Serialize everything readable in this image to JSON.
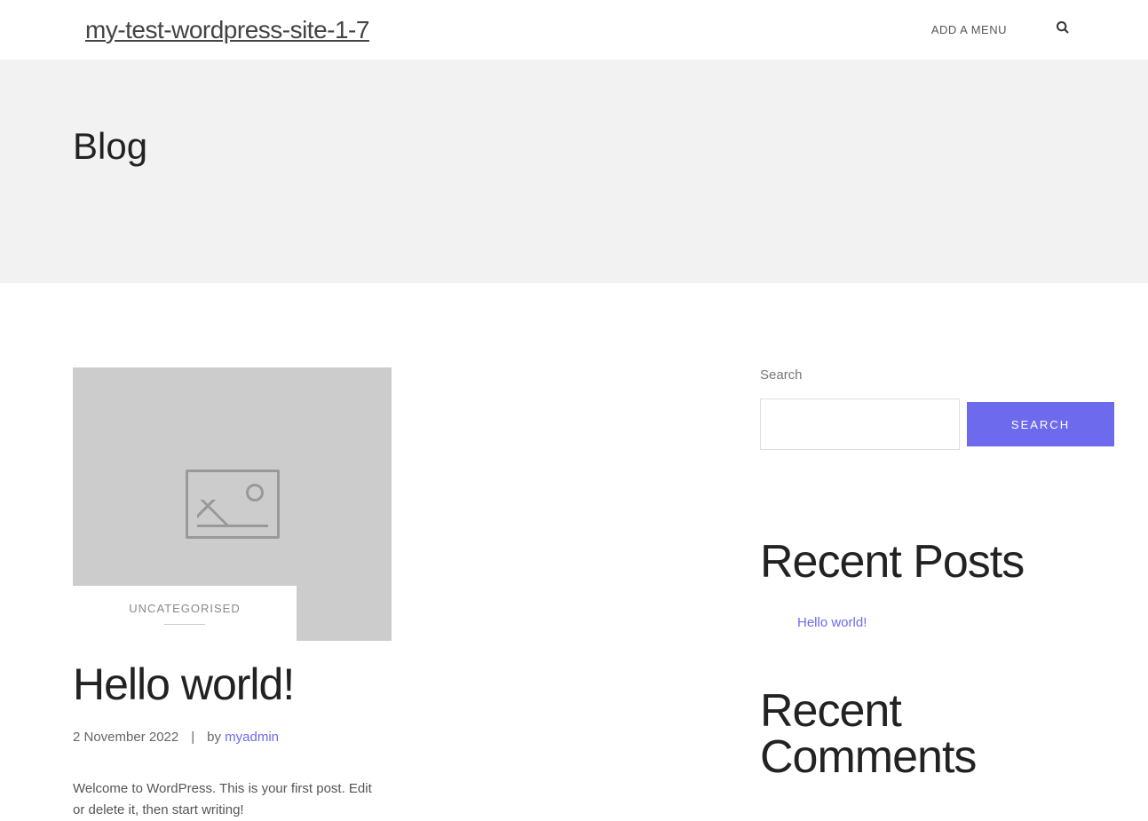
{
  "header": {
    "site_title": "my-test-wordpress-site-1-7",
    "add_menu": "ADD A MENU"
  },
  "page": {
    "title": "Blog"
  },
  "post": {
    "category": "UNCATEGORISED",
    "title": "Hello world!",
    "date": "2 November 2022",
    "by": "by",
    "author": "myadmin",
    "excerpt": "Welcome to WordPress. This is your first post. Edit or delete it, then start writing!"
  },
  "sidebar": {
    "search_label": "Search",
    "search_button": "SEARCH",
    "recent_posts_title": "Recent Posts",
    "recent_posts": [
      {
        "label": "Hello world!"
      }
    ],
    "recent_comments_title": "Recent Comments"
  },
  "colors": {
    "accent": "#6d6aed",
    "page_header_bg": "#f2f2f2",
    "placeholder_bg": "#cccccc"
  }
}
